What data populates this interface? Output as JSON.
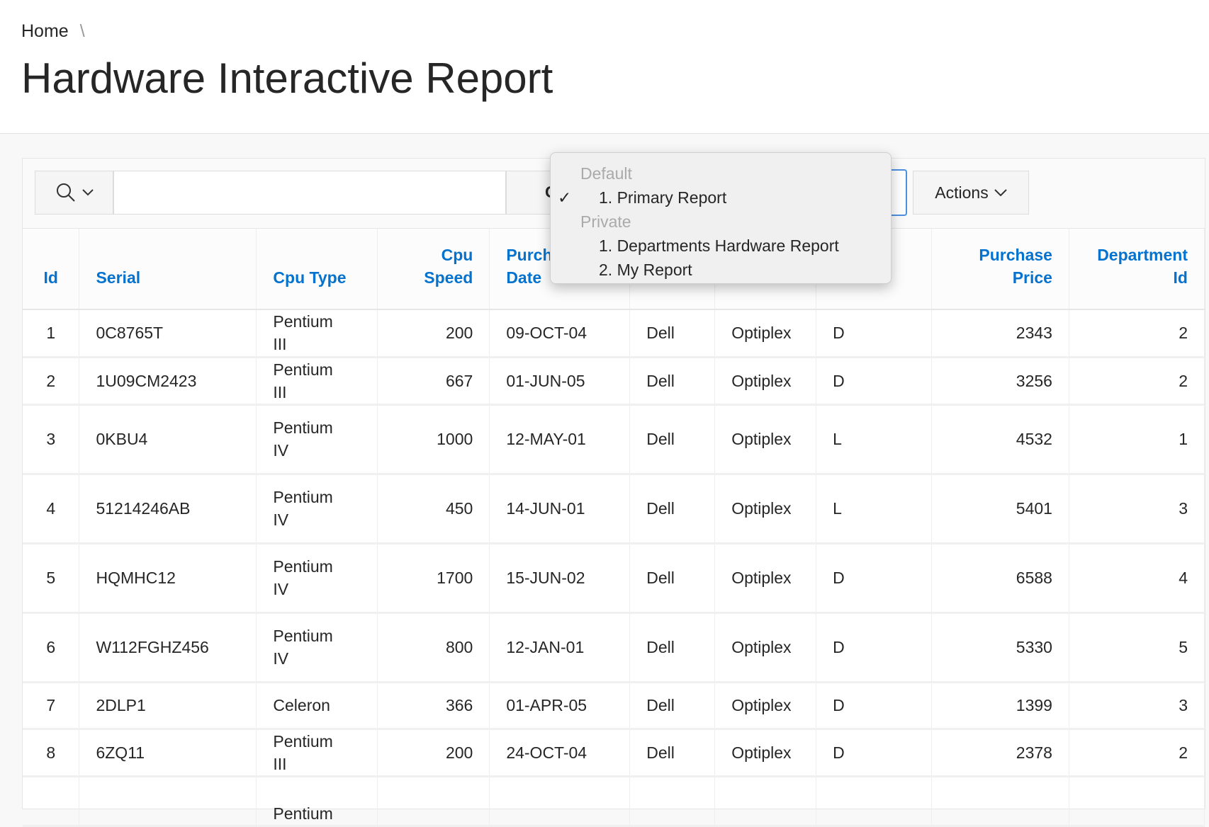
{
  "breadcrumb": {
    "home": "Home",
    "sep": "\\"
  },
  "page_title": "Hardware Interactive Report",
  "toolbar": {
    "go": "Go",
    "actions": "Actions"
  },
  "menu": {
    "groups": [
      {
        "label": "Default",
        "items": [
          {
            "label": "1. Primary Report",
            "checked": true
          }
        ]
      },
      {
        "label": "Private",
        "items": [
          {
            "label": "1. Departments Hardware Report"
          },
          {
            "label": "2. My Report"
          }
        ]
      }
    ],
    "check": "✓"
  },
  "columns": [
    "Id",
    "Serial",
    "Cpu Type",
    "Cpu Speed",
    "Purchase Date",
    "",
    "",
    "",
    "Purchase Price",
    "Department Id"
  ],
  "rows": [
    [
      "1",
      "0C8765T",
      "Pentium III",
      "200",
      "09-OCT-04",
      "Dell",
      "Optiplex",
      "D",
      "2343",
      "2"
    ],
    [
      "2",
      "1U09CM2423",
      "Pentium III",
      "667",
      "01-JUN-05",
      "Dell",
      "Optiplex",
      "D",
      "3256",
      "2"
    ],
    [
      "3",
      "0KBU4",
      "Pentium IV",
      "1000",
      "12-MAY-01",
      "Dell",
      "Optiplex",
      "L",
      "4532",
      "1"
    ],
    [
      "4",
      "51214246AB",
      "Pentium IV",
      "450",
      "14-JUN-01",
      "Dell",
      "Optiplex",
      "L",
      "5401",
      "3"
    ],
    [
      "5",
      "HQMHC12",
      "Pentium IV",
      "1700",
      "15-JUN-02",
      "Dell",
      "Optiplex",
      "D",
      "6588",
      "4"
    ],
    [
      "6",
      "W112FGHZ456",
      "Pentium IV",
      "800",
      "12-JAN-01",
      "Dell",
      "Optiplex",
      "D",
      "5330",
      "5"
    ],
    [
      "7",
      "2DLP1",
      "Celeron",
      "366",
      "01-APR-05",
      "Dell",
      "Optiplex",
      "D",
      "1399",
      "3"
    ],
    [
      "8",
      "6ZQ11",
      "Pentium III",
      "200",
      "24-OCT-04",
      "Dell",
      "Optiplex",
      "D",
      "2378",
      "2"
    ],
    [
      "",
      "",
      "Pentium",
      "",
      "",
      "",
      "",
      "",
      "",
      ""
    ]
  ]
}
